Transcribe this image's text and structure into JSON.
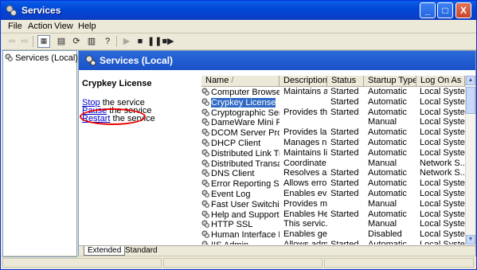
{
  "window": {
    "title": "Services",
    "controls": {
      "minimize": "_",
      "maximize": "□",
      "close": "X"
    }
  },
  "menu": [
    "File",
    "Action",
    "View",
    "Help"
  ],
  "toolbar_icons": [
    "back-arrow-icon",
    "forward-arrow-icon",
    "show-hide-tree-icon",
    "properties-icon",
    "refresh-icon",
    "help-icon",
    "play-icon",
    "stop-icon",
    "pause-icon",
    "restart-icon"
  ],
  "tree": {
    "root": "Services (Local)"
  },
  "panel": {
    "header": "Services (Local)",
    "selected_service": "Crypkey License",
    "actions": {
      "stop_link": "Stop",
      "stop_rest": " the service",
      "pause_link": "Pause",
      "pause_rest": " the service",
      "restart_link": "Restart",
      "restart_rest": " the service"
    }
  },
  "columns": [
    "Name",
    "Description",
    "Status",
    "Startup Type",
    "Log On As"
  ],
  "rows": [
    {
      "name": "Computer Browser",
      "description": "Maintains a...",
      "status": "Started",
      "startup": "Automatic",
      "logon": "Local System"
    },
    {
      "name": "Crypkey License",
      "description": "",
      "status": "Started",
      "startup": "Automatic",
      "logon": "Local System",
      "selected": true
    },
    {
      "name": "Cryptographic Servi...",
      "description": "Provides th...",
      "status": "Started",
      "startup": "Automatic",
      "logon": "Local System"
    },
    {
      "name": "DameWare Mini Re...",
      "description": "",
      "status": "",
      "startup": "Manual",
      "logon": "Local System"
    },
    {
      "name": "DCOM Server Proce...",
      "description": "Provides la...",
      "status": "Started",
      "startup": "Automatic",
      "logon": "Local System"
    },
    {
      "name": "DHCP Client",
      "description": "Manages n...",
      "status": "Started",
      "startup": "Automatic",
      "logon": "Local System"
    },
    {
      "name": "Distributed Link Tra...",
      "description": "Maintains li...",
      "status": "Started",
      "startup": "Automatic",
      "logon": "Local System"
    },
    {
      "name": "Distributed Transac...",
      "description": "Coordinate...",
      "status": "",
      "startup": "Manual",
      "logon": "Network S..."
    },
    {
      "name": "DNS Client",
      "description": "Resolves a...",
      "status": "Started",
      "startup": "Automatic",
      "logon": "Network S..."
    },
    {
      "name": "Error Reporting Ser...",
      "description": "Allows erro...",
      "status": "Started",
      "startup": "Automatic",
      "logon": "Local System"
    },
    {
      "name": "Event Log",
      "description": "Enables ev...",
      "status": "Started",
      "startup": "Automatic",
      "logon": "Local System"
    },
    {
      "name": "Fast User Switching...",
      "description": "Provides m...",
      "status": "",
      "startup": "Manual",
      "logon": "Local System"
    },
    {
      "name": "Help and Support",
      "description": "Enables He...",
      "status": "Started",
      "startup": "Automatic",
      "logon": "Local System"
    },
    {
      "name": "HTTP SSL",
      "description": "This servic...",
      "status": "",
      "startup": "Manual",
      "logon": "Local System"
    },
    {
      "name": "Human Interface D...",
      "description": "Enables ge...",
      "status": "",
      "startup": "Disabled",
      "logon": "Local System"
    },
    {
      "name": "IIS Admin",
      "description": "Allows adm...",
      "status": "Started",
      "startup": "Automatic",
      "logon": "Local System"
    }
  ],
  "tabs": [
    "Extended",
    "Standard"
  ]
}
